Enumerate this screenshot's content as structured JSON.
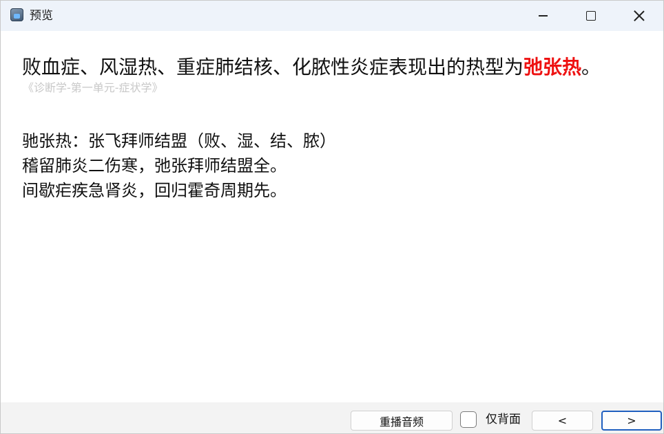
{
  "window": {
    "title": "预览"
  },
  "card": {
    "question_main": "败血症、风湿热、重症肺结核、化脓性炎症表现出的热型为",
    "answer": "弛张热",
    "question_end": "。",
    "source": "《诊断学-第一单元-症状学》",
    "notes": [
      "驰张热：张飞拜师结盟（败、湿、结、脓）",
      "稽留肺炎二伤寒，弛张拜师结盟全。",
      "间歇疟疾急肾炎，回归霍奇周期先。"
    ]
  },
  "footer": {
    "replay_label": "重播音频",
    "back_only_label": "仅背面",
    "back_only_checked": false,
    "prev_label": "<",
    "next_label": ">"
  },
  "colors": {
    "answer": "#ee1111",
    "titlebar": "#eef3fa",
    "footer": "#f3f3f3",
    "focus_border": "#1f5fbf"
  },
  "icons": {
    "app": "app-icon",
    "minimize": "minimize-icon",
    "maximize": "maximize-icon",
    "close": "close-icon"
  }
}
